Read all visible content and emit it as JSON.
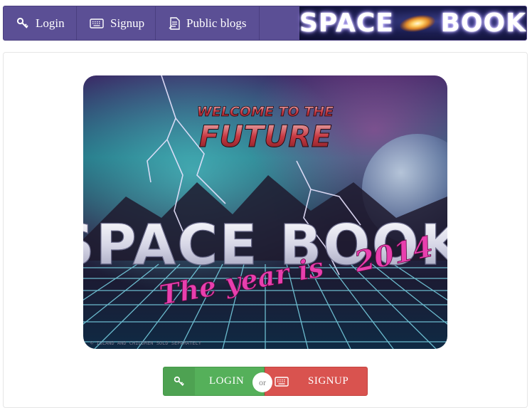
{
  "nav": {
    "items": [
      {
        "label": "Login",
        "icon": "key-icon"
      },
      {
        "label": "Signup",
        "icon": "keyboard-icon"
      },
      {
        "label": "Public blogs",
        "icon": "compose-icon"
      }
    ]
  },
  "logo": {
    "left_word": "SPACE",
    "right_word": "BOOK"
  },
  "hero": {
    "tagline_top": "WELCOME TO THE",
    "tagline_main": "FUTURE",
    "title": "SPACE BOOK",
    "subtitle_left": "The year is",
    "subtitle_year": "2014",
    "footer_note": "© ISLAND AND CHILDREN SOLD SEPARATELY"
  },
  "actions": {
    "login_label": "LOGIN",
    "or_label": "or",
    "signup_label": "SIGNUP"
  },
  "colors": {
    "navbar": "#5b4f95",
    "login_button": "#55b05a",
    "signup_button": "#d9534f"
  }
}
